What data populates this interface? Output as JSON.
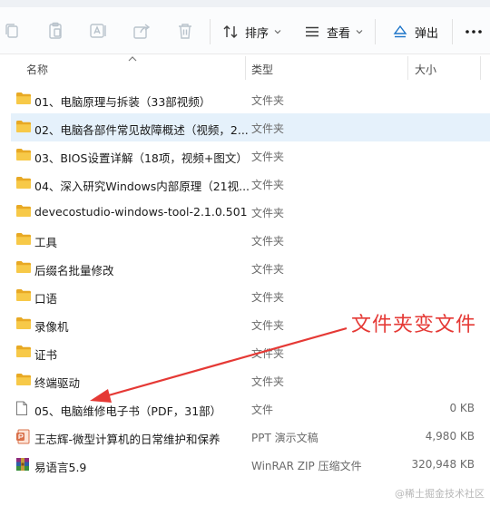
{
  "toolbar": {
    "sort_label": "排序",
    "view_label": "查看",
    "eject_label": "弹出",
    "more_label": "..."
  },
  "columns": {
    "name": "名称",
    "type": "类型",
    "size": "大小"
  },
  "files": [
    {
      "name": "01、电脑原理与拆装（33部视频）",
      "type": "文件夹",
      "size": "",
      "icon": "folder-icon",
      "selected": false
    },
    {
      "name": "02、电脑各部件常见故障概述（视频，2...",
      "type": "文件夹",
      "size": "",
      "icon": "folder-icon",
      "selected": true
    },
    {
      "name": "03、BIOS设置详解（18项，视频+图文）",
      "type": "文件夹",
      "size": "",
      "icon": "folder-icon",
      "selected": false
    },
    {
      "name": "04、深入研究Windows内部原理（21视...",
      "type": "文件夹",
      "size": "",
      "icon": "folder-icon",
      "selected": false
    },
    {
      "name": "devecostudio-windows-tool-2.1.0.501",
      "type": "文件夹",
      "size": "",
      "icon": "folder-icon",
      "selected": false
    },
    {
      "name": "工具",
      "type": "文件夹",
      "size": "",
      "icon": "folder-icon",
      "selected": false
    },
    {
      "name": "后缀名批量修改",
      "type": "文件夹",
      "size": "",
      "icon": "folder-icon",
      "selected": false
    },
    {
      "name": "口语",
      "type": "文件夹",
      "size": "",
      "icon": "folder-icon",
      "selected": false
    },
    {
      "name": "录像机",
      "type": "文件夹",
      "size": "",
      "icon": "folder-icon",
      "selected": false
    },
    {
      "name": "证书",
      "type": "文件夹",
      "size": "",
      "icon": "folder-icon",
      "selected": false
    },
    {
      "name": "终端驱动",
      "type": "文件夹",
      "size": "",
      "icon": "folder-icon",
      "selected": false
    },
    {
      "name": "05、电脑维修电子书（PDF，31部）",
      "type": "文件",
      "size": "0 KB",
      "icon": "blank-file-icon",
      "selected": false
    },
    {
      "name": "王志辉-微型计算机的日常维护和保养",
      "type": "PPT 演示文稿",
      "size": "4,980 KB",
      "icon": "ppt-file-icon",
      "selected": false
    },
    {
      "name": "易语言5.9",
      "type": "WinRAR ZIP 压缩文件",
      "size": "320,948 KB",
      "icon": "zip-archive-icon",
      "selected": false
    }
  ],
  "annotation": {
    "text": "文件夹变文件",
    "color": "#e53935"
  },
  "watermark": "@稀土掘金技术社区",
  "colors": {
    "folder": "#f7c948",
    "folder_dark": "#e8a924",
    "selected_row": "#e5f1fb",
    "accent": "#1a73c8"
  }
}
